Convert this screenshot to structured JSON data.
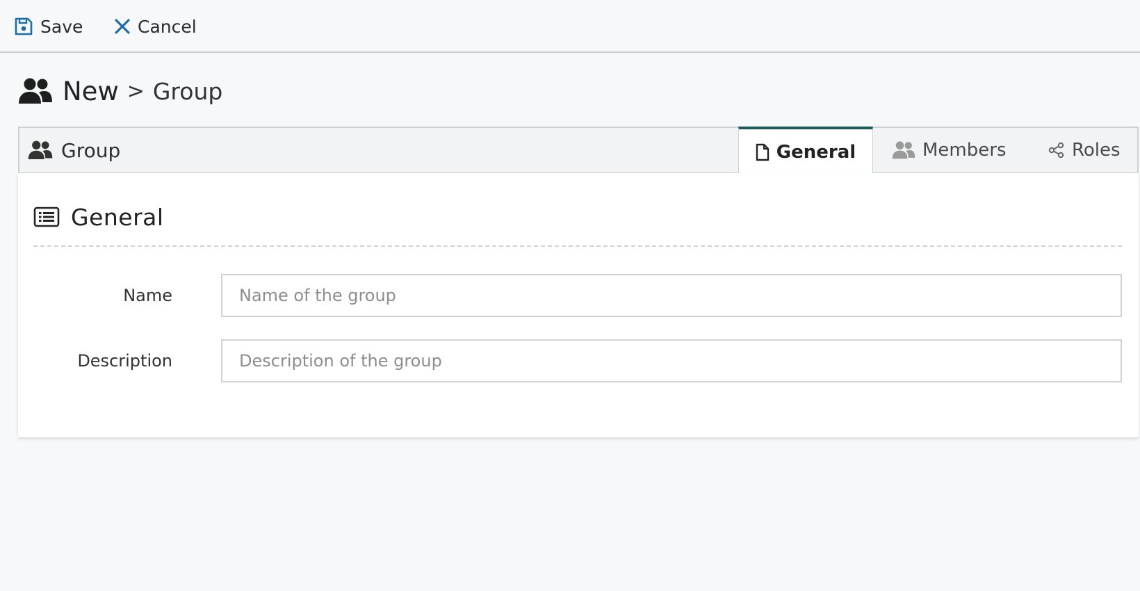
{
  "toolbar": {
    "save_label": "Save",
    "cancel_label": "Cancel",
    "save_icon": "floppy-disk-icon",
    "cancel_icon": "close-icon",
    "accent_color": "#1a6ea8"
  },
  "breadcrumb": {
    "icon": "users-icon",
    "first": "New",
    "separator": ">",
    "second": "Group"
  },
  "tabbar": {
    "entity_label": "Group",
    "tabs": [
      {
        "label": "General",
        "icon": "document-icon",
        "active": true
      },
      {
        "label": "Members",
        "icon": "users-icon",
        "active": false
      },
      {
        "label": "Roles",
        "icon": "share-nodes-icon",
        "active": false
      }
    ],
    "active_tab_color": "#1f5a58"
  },
  "section": {
    "title": "General",
    "icon": "list-icon"
  },
  "form": {
    "name_label": "Name",
    "name_placeholder": "Name of the group",
    "name_value": "",
    "description_label": "Description",
    "description_placeholder": "Description of the group",
    "description_value": ""
  }
}
